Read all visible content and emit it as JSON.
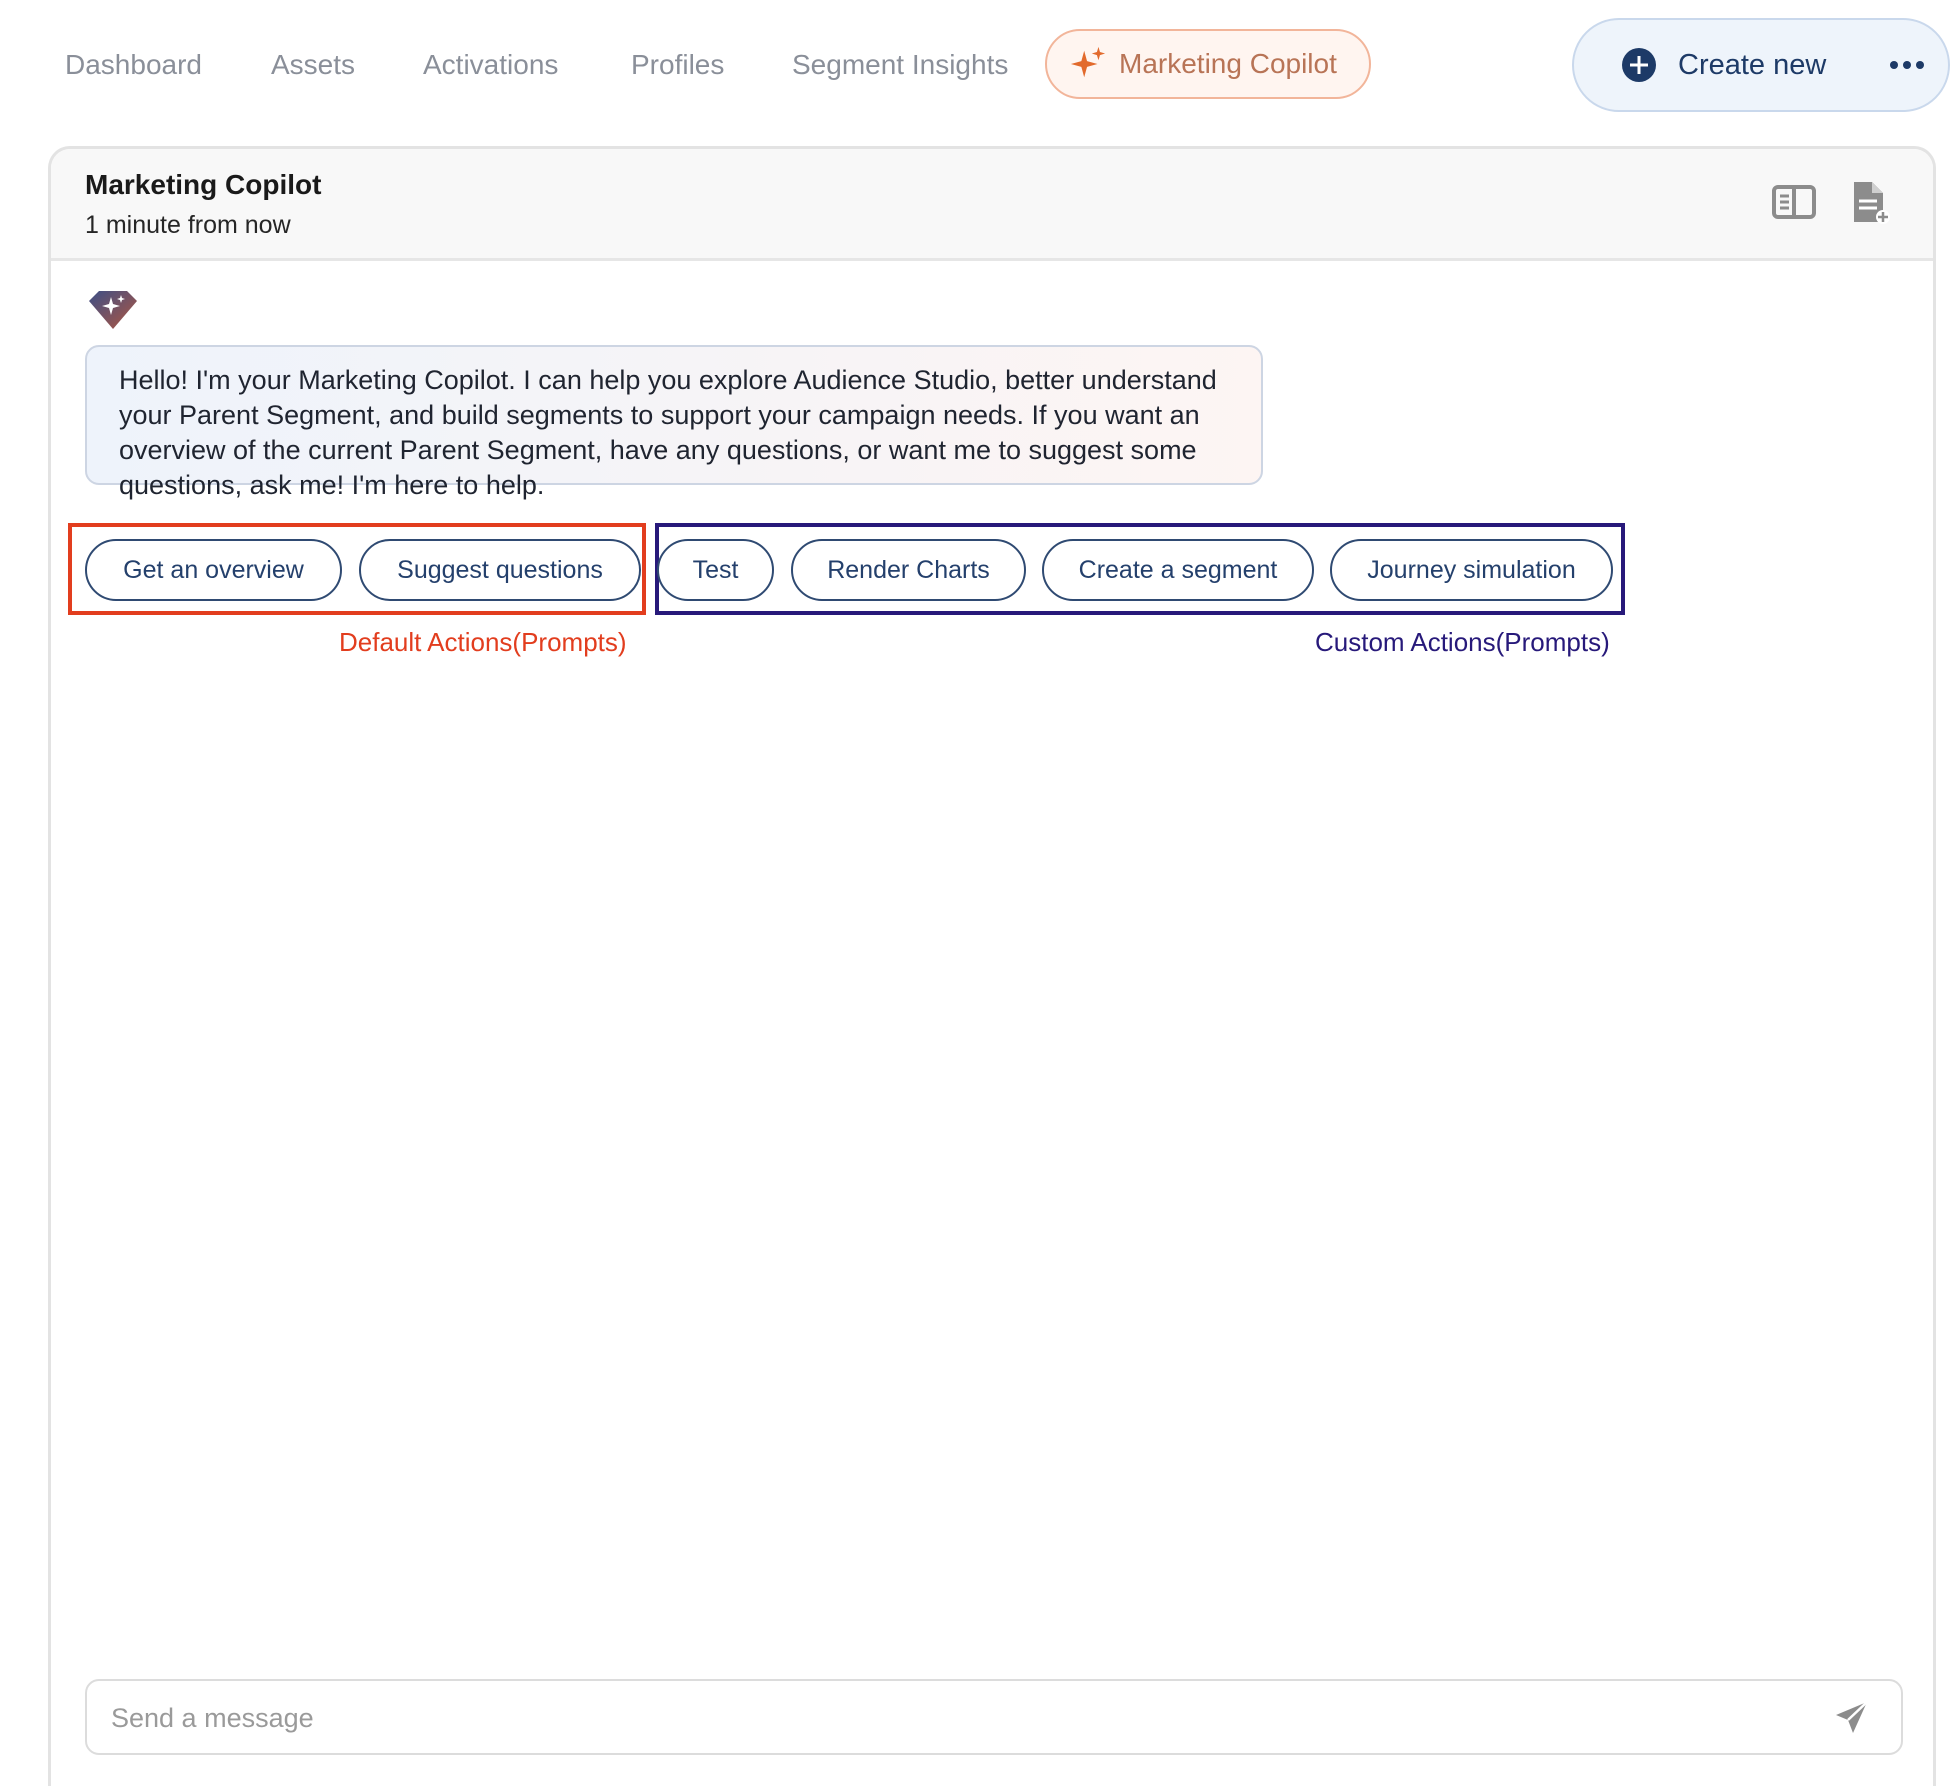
{
  "nav": {
    "tabs": [
      {
        "label": "Dashboard"
      },
      {
        "label": "Assets"
      },
      {
        "label": "Activations"
      },
      {
        "label": "Profiles"
      },
      {
        "label": "Segment Insights"
      },
      {
        "label": "Marketing Copilot",
        "active": true,
        "icon": "sparkle-icon"
      }
    ],
    "create_label": "Create new",
    "create_icon": "plus-circle-icon",
    "more_icon": "more-horizontal-icon"
  },
  "panel": {
    "title": "Marketing Copilot",
    "subtitle": "1 minute from now",
    "header_icons": [
      "split-view-icon",
      "new-document-icon"
    ]
  },
  "chat": {
    "avatar_icon": "copilot-gem-icon",
    "message": "Hello! I'm your Marketing Copilot. I can help you explore Audience Studio, better understand your Parent Segment, and build segments to support your campaign needs. If you want an overview of the current Parent Segment, have any questions, or want me to suggest some questions, ask me! I'm here to help."
  },
  "actions": {
    "default": [
      "Get an overview",
      "Suggest questions"
    ],
    "custom": [
      "Test",
      "Render Charts",
      "Create a segment",
      "Journey simulation"
    ],
    "default_label": "Default Actions(Prompts)",
    "custom_label": "Custom Actions(Prompts)"
  },
  "composer": {
    "placeholder": "Send a message",
    "send_icon": "send-icon"
  },
  "colors": {
    "accent": "#1d3a67",
    "active_tab_text": "#b87456",
    "active_tab_border": "#f2b59a",
    "default_actions_box": "#e23d1e",
    "custom_actions_box": "#27197a"
  }
}
